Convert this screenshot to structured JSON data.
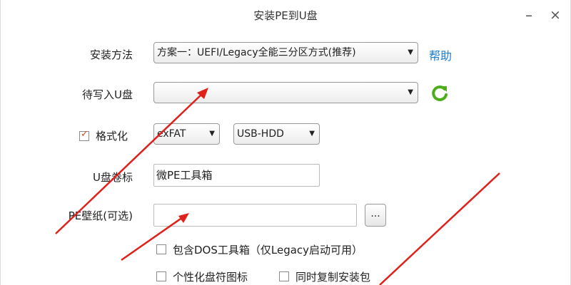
{
  "window": {
    "title": "安装PE到U盘",
    "minimize": "–",
    "close": "×"
  },
  "install_method": {
    "label": "安装方法",
    "value": "方案一：UEFI/Legacy全能三分区方式(推荐)",
    "help": "帮助"
  },
  "target_disk": {
    "label": "待写入U盘",
    "value": ""
  },
  "format": {
    "label": "格式化",
    "checked": true,
    "filesystem": "exFAT",
    "mode": "USB-HDD"
  },
  "volume_label": {
    "label": "U盘卷标",
    "value": "微PE工具箱"
  },
  "wallpaper": {
    "label": "PE壁纸(可选)",
    "value": "",
    "browse": "..."
  },
  "options": {
    "dos_tools": "包含DOS工具箱（仅Legacy启动可用）",
    "custom_icon": "个性化盘符图标",
    "copy_package": "同时复制安装包"
  },
  "colors": {
    "accent": "#1a7ccf",
    "annotation_arrow": "#e0201b",
    "refresh": "#4caf1a"
  }
}
